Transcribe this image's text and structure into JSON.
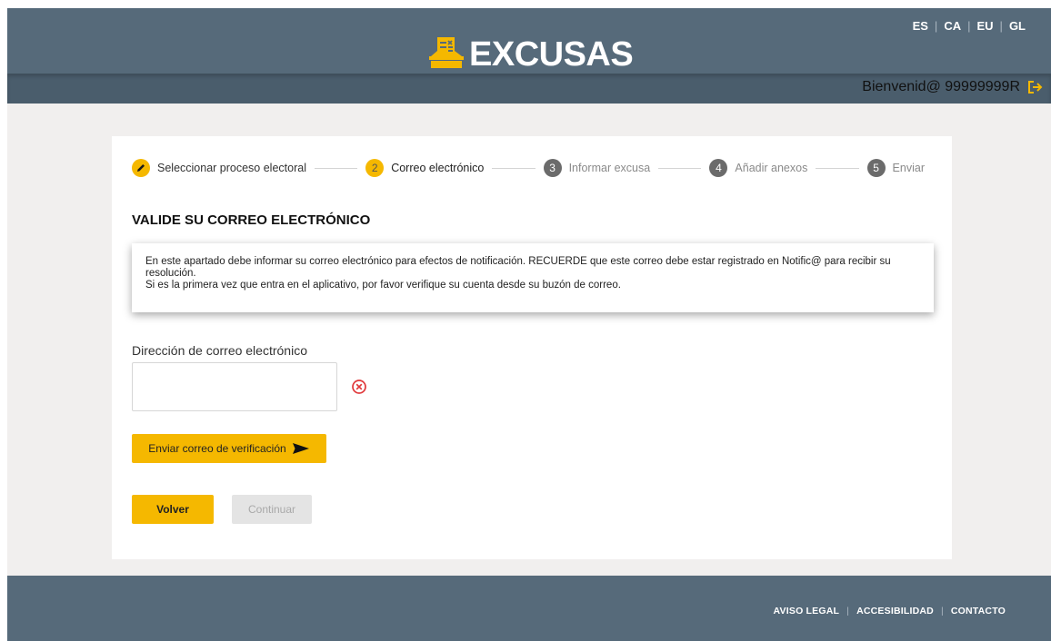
{
  "header": {
    "logo_text": "EXCUSAS",
    "languages": [
      "ES",
      "CA",
      "EU",
      "GL"
    ],
    "welcome": "Bienvenid@ 99999999R"
  },
  "stepper": {
    "steps": [
      {
        "number": "1",
        "label": "Seleccionar proceso electoral",
        "state": "done"
      },
      {
        "number": "2",
        "label": "Correo electrónico",
        "state": "active"
      },
      {
        "number": "3",
        "label": "Informar excusa",
        "state": "todo"
      },
      {
        "number": "4",
        "label": "Añadir anexos",
        "state": "todo"
      },
      {
        "number": "5",
        "label": "Enviar",
        "state": "todo"
      }
    ]
  },
  "main": {
    "title": "VALIDE SU CORREO ELECTRÓNICO",
    "notice_line1": "En este apartado debe informar su correo electrónico para efectos de notificación. RECUERDE que este correo debe estar registrado en Notific@ para recibir su resolución.",
    "notice_line2": "Si es la primera vez que entra en el aplicativo, por favor verifique su cuenta desde su buzón de correo.",
    "email_label": "Dirección de correo electrónico",
    "email_value": "",
    "email_placeholder": "",
    "send_button": "Enviar correo de verificación",
    "back_button": "Volver",
    "continue_button": "Continuar"
  },
  "footer": {
    "links": [
      "AVISO LEGAL",
      "ACCESIBILIDAD",
      "CONTACTO"
    ]
  },
  "colors": {
    "accent": "#f5b800",
    "header": "#566a7a",
    "error": "#e0373a",
    "step_todo": "#6b6b6b"
  },
  "icons": {
    "logo": "ballot-box-icon",
    "logout": "logout-icon",
    "step_done": "pencil-icon",
    "input_error": "error-circle-x-icon",
    "send": "send-arrow-icon"
  }
}
